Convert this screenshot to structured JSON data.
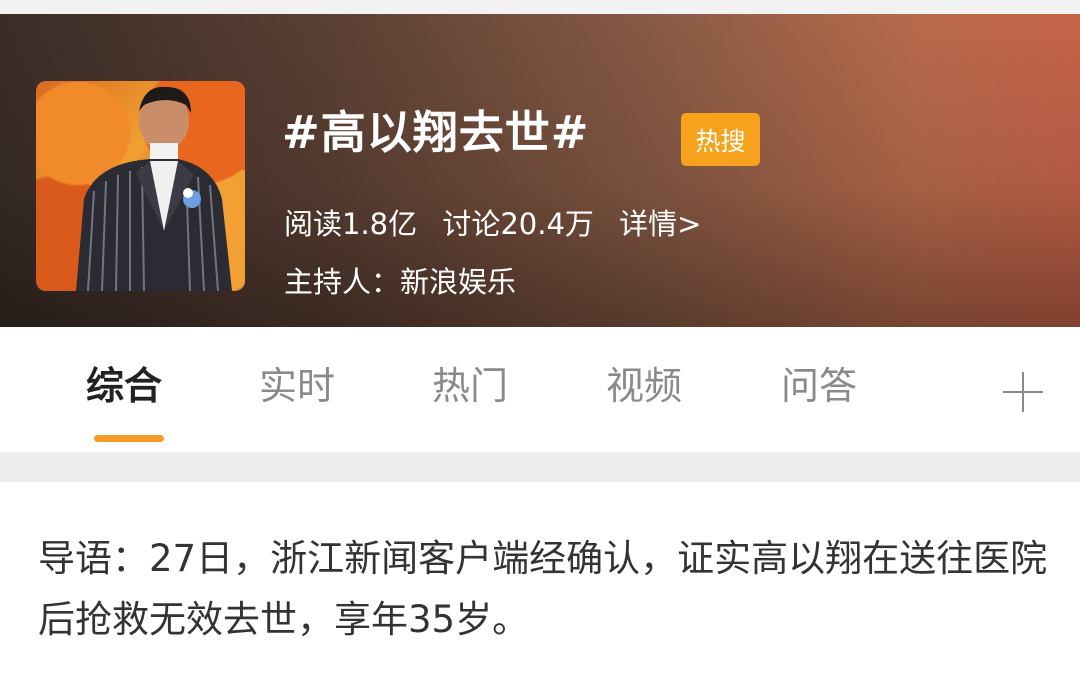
{
  "header": {
    "topic_title": "#高以翔去世#",
    "hot_badge": "热搜",
    "stats": {
      "reads": "阅读1.8亿",
      "discussions": "讨论20.4万",
      "details_link": "详情>"
    },
    "host": "主持人：新浪娱乐",
    "avatar_icon": "topic-avatar-photo"
  },
  "tabs": {
    "items": [
      {
        "label": "综合",
        "active": true
      },
      {
        "label": "实时",
        "active": false
      },
      {
        "label": "热门",
        "active": false
      },
      {
        "label": "视频",
        "active": false
      },
      {
        "label": "问答",
        "active": false
      }
    ],
    "add_icon": "plus-icon"
  },
  "intro": {
    "text": "导语：27日，浙江新闻客户端经确认，证实高以翔在送往医院后抢救无效去世，享年35岁。"
  },
  "colors": {
    "accent": "#f59a23",
    "badge": "#f6a21c",
    "tab_inactive": "#8a8a8a"
  }
}
